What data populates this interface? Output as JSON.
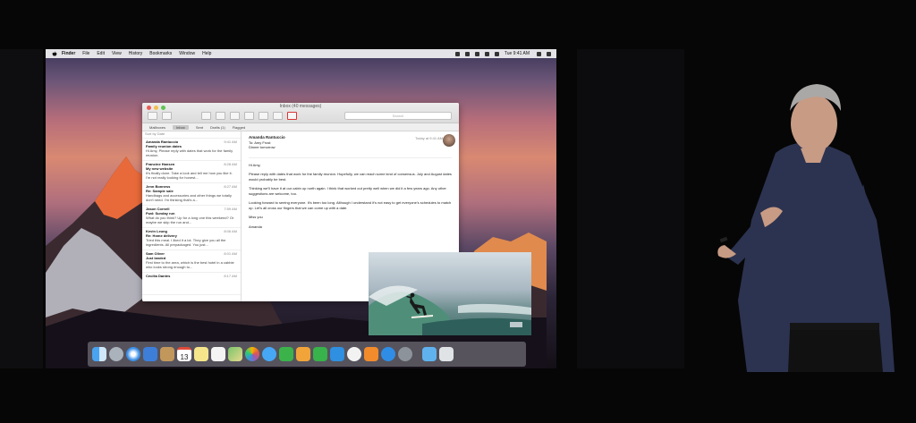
{
  "menubar": {
    "app": "Finder",
    "items": [
      "File",
      "Edit",
      "View",
      "History",
      "Bookmarks",
      "Window",
      "Help"
    ],
    "clock": "Tue 9:41 AM"
  },
  "mail": {
    "window_title": "Inbox (40 messages)",
    "search_placeholder": "Search",
    "favorites": [
      "Mailboxes",
      "Inbox",
      "Sent",
      "Drafts (1)",
      "Flagged"
    ],
    "sort_label": "Sort by Date",
    "messages": [
      {
        "from": "Amanda Rantuccio",
        "time": "9:41 AM",
        "subject": "Family reunion dates",
        "preview": "Hi Amy, Please reply with dates that work for the family reunion."
      },
      {
        "from": "Francine Hansen",
        "time": "8:28 AM",
        "subject": "My new website",
        "preview": "It's finally done. Take a look and tell me how you like it. I'm not really looking for honest..."
      },
      {
        "from": "Jenn Bonness",
        "time": "8:27 AM",
        "subject": "Re: Sample sale",
        "preview": "Handbags and accessories and other things we totally don't need. I'm thinking that's a..."
      },
      {
        "from": "Jason Cornell",
        "time": "7:59 AM",
        "subject": "Fwd: Sunday run",
        "preview": "What do you think? Up for a long one this weekend? Or maybe we skip the run and..."
      },
      {
        "from": "Kevin Leung",
        "time": "8:06 AM",
        "subject": "Re: Home delivery",
        "preview": "Tried this meal. I liked it a lot. They give you all the ingredients. All prepackaged. You just..."
      },
      {
        "from": "Sam Oliver",
        "time": "8:01 AM",
        "subject": "Just landed",
        "preview": "First time to the area, which is the best hotel in a cabbie who looks strong enough to..."
      },
      {
        "from": "Cecilia Dantes",
        "time": "8:17 AM",
        "subject": "",
        "preview": ""
      }
    ],
    "reading": {
      "from": "Amanda Rantuccio",
      "date": "Today at 9:41 AM",
      "to": "To: Amy Frost",
      "subject": "Dinner tomorrow",
      "greeting": "Hi Amy,",
      "p1": "Please reply with dates that work for the family reunion. Hopefully, we can reach some kind of consensus. July and August dates would probably be best.",
      "p2": "Thinking we'll have it at our cabin up north again. I think that worked out pretty well when we did it a few years ago. Any other suggestions are welcome, too.",
      "p3": "Looking forward to seeing everyone. It's been too long. Although I understand it's not easy to get everyone's schedules to match up. Let's all cross our fingers that we can come up with a date.",
      "signoff": "Miss you",
      "signature": "Amanda"
    }
  },
  "dock": {
    "icons": [
      "finder-icon",
      "launchpad-icon",
      "safari-icon",
      "mail-icon",
      "contacts-icon",
      "calendar-icon",
      "notes-icon",
      "reminders-icon",
      "maps-icon",
      "photos-icon",
      "messages-icon",
      "facetime-icon",
      "pages-icon",
      "numbers-icon",
      "keynote-icon",
      "itunes-icon",
      "ibooks-icon",
      "app-store-icon",
      "system-preferences-icon",
      "downloads-folder-icon",
      "trash-icon"
    ],
    "calendar_day": "13"
  }
}
